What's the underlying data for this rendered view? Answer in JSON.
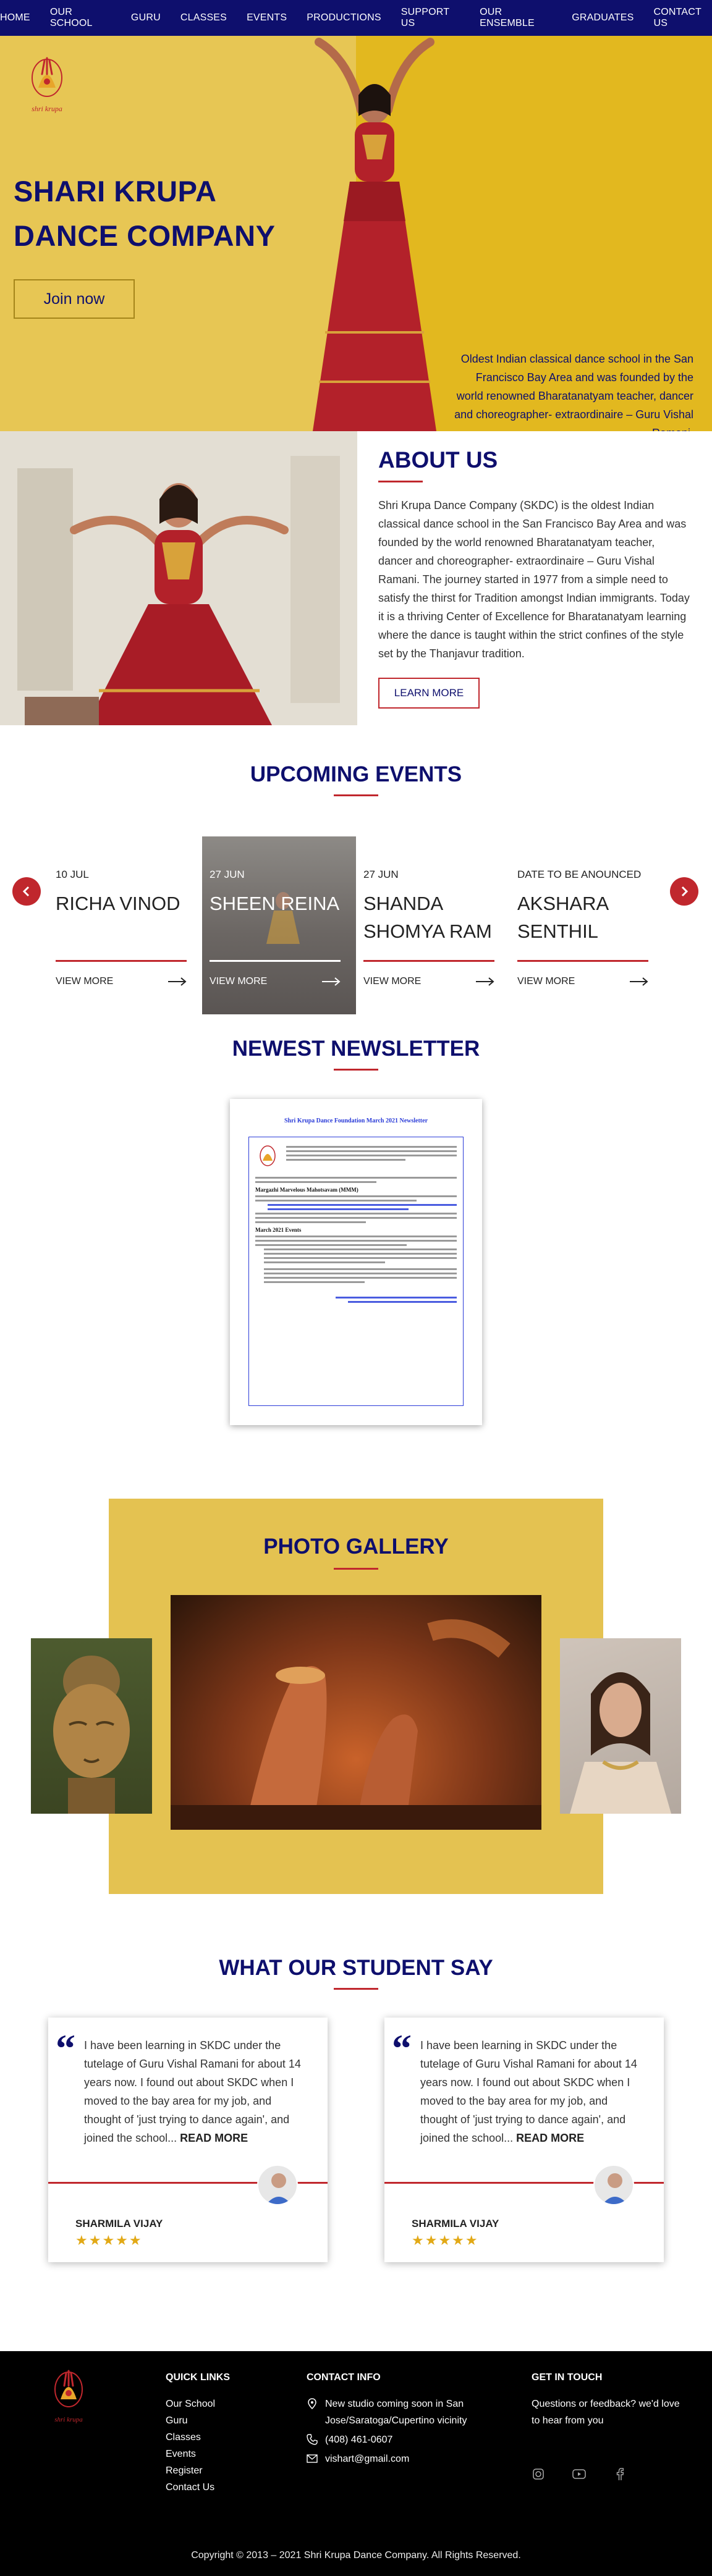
{
  "nav": [
    "HOME",
    "OUR SCHOOL",
    "GURU",
    "CLASSES",
    "EVENTS",
    "PRODUCTIONS",
    "SUPPORT US",
    "OUR ENSEMBLE",
    "GRADUATES",
    "CONTACT US"
  ],
  "hero": {
    "title_line1": "SHARI KRUPA",
    "title_line2": "DANCE COMPANY",
    "button": "Join now",
    "description": "Oldest Indian classical dance school in the San Francisco Bay Area and was founded by the world renowned Bharatanatyam teacher, dancer and choreographer- extraordinaire – Guru Vishal Ramani.",
    "logo_text": "shri krupa"
  },
  "about": {
    "title": "ABOUT US",
    "text": "Shri Krupa Dance Company (SKDC) is the oldest Indian classical dance school in the San Francisco Bay Area and was founded by the world renowned Bharatanatyam teacher, dancer and choreographer- extraordinaire – Guru Vishal Ramani. The journey started in 1977 from a simple need to satisfy the thirst for Tradition amongst Indian immigrants. Today it is a thriving Center of Excellence for Bharatanatyam learning where the dance is taught within the strict confines of the style set by the Thanjavur tradition.",
    "button": "LEARN MORE"
  },
  "events": {
    "title": "UPCOMING EVENTS",
    "items": [
      {
        "date": "10 JUL",
        "name": "RICHA VINOD",
        "more": "VIEW MORE"
      },
      {
        "date": "27 JUN",
        "name": "SHEEN REINA",
        "more": "VIEW MORE"
      },
      {
        "date": "27 JUN",
        "name": "SHANDA SHOMYA RAM",
        "more": "VIEW MORE"
      },
      {
        "date": "DATE TO BE ANOUNCED",
        "name": "AKSHARA SENTHIL",
        "more": "VIEW MORE"
      }
    ],
    "prev_icon": "chevron-left-icon",
    "next_icon": "chevron-right-icon"
  },
  "newsletter": {
    "title": "NEWEST NEWSLETTER",
    "doc_title": "Shri Krupa Dance Foundation March 2021 Newsletter",
    "heading1": "Margazhi Marvelous Mahotsavam (MMM)",
    "heading2": "March 2021 Events"
  },
  "gallery": {
    "title": "PHOTO GALLERY"
  },
  "testimonials": {
    "title": "WHAT OUR STUDENT SAY",
    "items": [
      {
        "text": "I have been learning in SKDC under the tutelage of Guru Vishal Ramani for about 14 years now. I found out about SKDC when I moved to the bay area for my job, and thought of 'just trying to dance again', and joined the school...",
        "more": "READ MORE",
        "name": "SHARMILA VIJAY",
        "stars": "★★★★★"
      },
      {
        "text": "I have been learning in SKDC under the tutelage of Guru Vishal Ramani for about 14 years now. I found out about SKDC when I moved to the bay area for my job, and thought of 'just trying to dance again', and joined the school...",
        "more": "READ MORE",
        "name": "SHARMILA VIJAY",
        "stars": "★★★★★"
      }
    ]
  },
  "footer": {
    "quick_links_title": "QUICK LINKS",
    "quick_links": [
      "Our School",
      "Guru",
      "Classes",
      "Events",
      "Register",
      "Contact Us"
    ],
    "contact_title": "CONTACT INFO",
    "address": "New studio coming soon in San Jose/Saratoga/Cupertino vicinity",
    "phone": "(408) 461-0607",
    "email": "vishart@gmail.com",
    "touch_title": "GET IN TOUCH",
    "touch_text": "Questions or feedback? we'd love to hear from you",
    "social_icons": [
      "instagram-icon",
      "youtube-icon",
      "facebook-icon"
    ],
    "copyright": "Copyright © 2013 – 2021 Shri Krupa Dance Company. All Rights Reserved.",
    "logo_text": "shri krupa"
  },
  "colors": {
    "navy": "#0e0f6d",
    "red": "#c0272d",
    "gold": "#e2b81f",
    "gold_light": "#e7c654",
    "star": "#e2a916"
  }
}
